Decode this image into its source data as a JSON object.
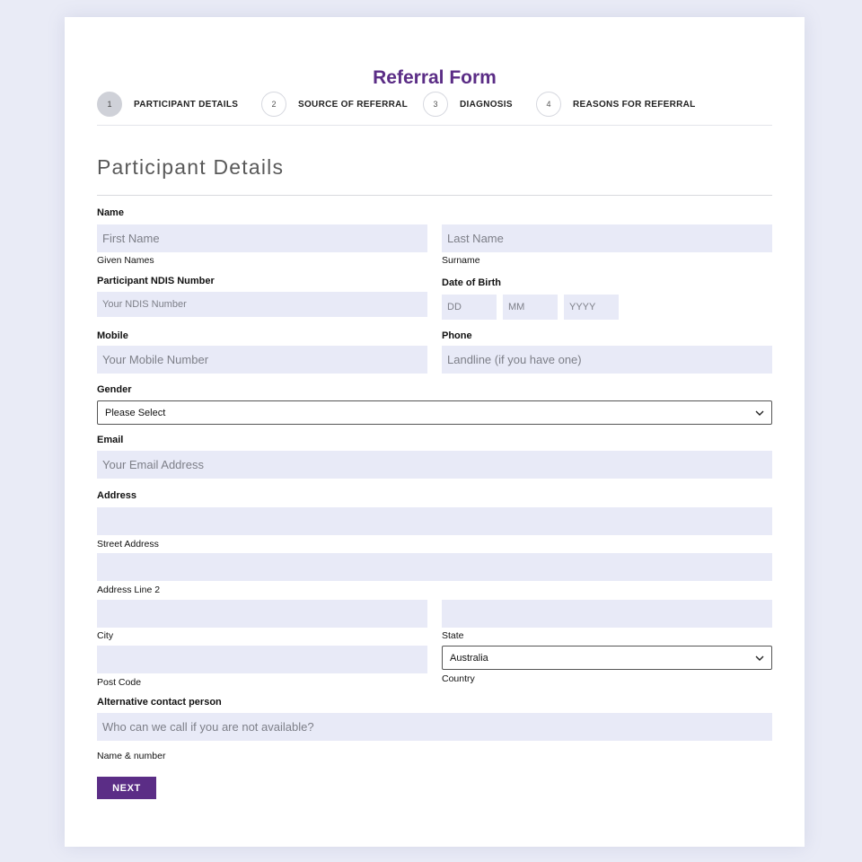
{
  "form": {
    "title": "Referral Form",
    "section_title": "Participant Details"
  },
  "steps": [
    {
      "number": "1",
      "label": "PARTICIPANT DETAILS",
      "active": true
    },
    {
      "number": "2",
      "label": "SOURCE OF REFERRAL",
      "active": false
    },
    {
      "number": "3",
      "label": "DIAGNOSIS",
      "active": false
    },
    {
      "number": "4",
      "label": "REASONS FOR REFERRAL",
      "active": false
    }
  ],
  "fields": {
    "name": {
      "label": "Name",
      "first_placeholder": "First Name",
      "first_sublabel": "Given Names",
      "last_placeholder": "Last Name",
      "last_sublabel": "Surname"
    },
    "ndis": {
      "label": "Participant NDIS Number",
      "placeholder": "Your NDIS Number"
    },
    "dob": {
      "label": "Date of Birth",
      "day_placeholder": "DD",
      "month_placeholder": "MM",
      "year_placeholder": "YYYY"
    },
    "mobile": {
      "label": "Mobile",
      "placeholder": "Your Mobile Number"
    },
    "phone": {
      "label": "Phone",
      "placeholder": "Landline (if you have one)"
    },
    "gender": {
      "label": "Gender",
      "selected": "Please Select"
    },
    "email": {
      "label": "Email",
      "placeholder": "Your Email Address"
    },
    "address": {
      "label": "Address",
      "street_sublabel": "Street Address",
      "line2_sublabel": "Address Line 2",
      "city_sublabel": "City",
      "state_sublabel": "State",
      "postcode_sublabel": "Post Code",
      "country_selected": "Australia",
      "country_sublabel": "Country"
    },
    "alt_contact": {
      "label": "Alternative contact person",
      "placeholder": "Who can we call if you are not available?",
      "sublabel": "Name & number"
    }
  },
  "buttons": {
    "next": "NEXT"
  },
  "icons": {
    "select_arrow": "chevron-down-icon"
  },
  "colors": {
    "brand": "#5b2d86",
    "field_bg": "#e8eaf7",
    "page_bg": "#e9ebf6"
  }
}
